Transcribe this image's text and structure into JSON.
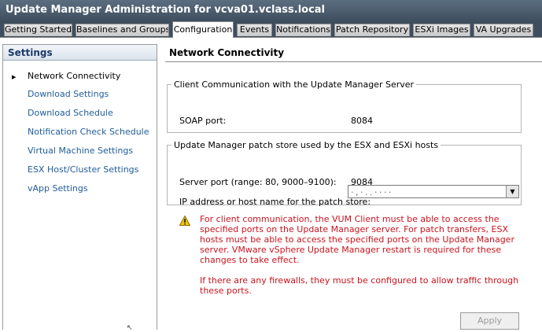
{
  "window": {
    "title": "Update Manager Administration for vcva01.vclass.local"
  },
  "tabs": [
    {
      "label": "Getting Started"
    },
    {
      "label": "Baselines and Groups"
    },
    {
      "label": "Configuration"
    },
    {
      "label": "Events"
    },
    {
      "label": "Notifications"
    },
    {
      "label": "Patch Repository"
    },
    {
      "label": "ESXi Images"
    },
    {
      "label": "VA Upgrades"
    }
  ],
  "active_tab": "Configuration",
  "sidebar": {
    "header": "Settings",
    "items": [
      {
        "label": "Network Connectivity"
      },
      {
        "label": "Download Settings"
      },
      {
        "label": "Download Schedule"
      },
      {
        "label": "Notification Check Schedule"
      },
      {
        "label": "Virtual Machine Settings"
      },
      {
        "label": "ESX Host/Cluster Settings"
      },
      {
        "label": "vApp Settings"
      }
    ]
  },
  "main": {
    "title": "Network Connectivity",
    "client_group": {
      "legend": "Client Communication with the Update Manager Server",
      "soap_label": "SOAP port:",
      "soap_value": "8084"
    },
    "patch_group": {
      "legend": "Update Manager patch store used by the ESX and ESXi hosts",
      "server_port_label": "Server port (range: 80, 9000–9100):",
      "server_port_value": "9084",
      "ip_label": "IP address or host name for the patch store:",
      "ip_value": "· ,  · .   . · · · · "
    },
    "warning": {
      "para1": "For client communication, the VUM Client must be able to access the specified ports on the Update Manager server. For patch transfers, ESX hosts must be able to access the specified ports on the Update Manager server. VMware vSphere Update Manager restart is required for these changes to take effect.",
      "para2": "If there are any firewalls, they must be configured to allow traffic through these ports.",
      "color": "#c8141e"
    },
    "apply_label": "Apply"
  }
}
